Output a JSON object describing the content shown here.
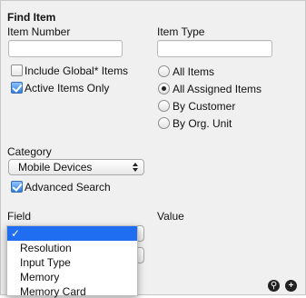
{
  "panel": {
    "title": "Find Item"
  },
  "item_number": {
    "label": "Item Number",
    "value": ""
  },
  "item_type": {
    "label": "Item Type",
    "value": "",
    "options": [
      {
        "label": "All Items",
        "selected": false
      },
      {
        "label": "All Assigned Items",
        "selected": true
      },
      {
        "label": "By Customer",
        "selected": false
      },
      {
        "label": "By Org. Unit",
        "selected": false
      }
    ]
  },
  "checkboxes": {
    "include_global": {
      "label": "Include Global* Items",
      "checked": false
    },
    "active_only": {
      "label": "Active Items Only",
      "checked": true
    },
    "advanced_search": {
      "label": "Advanced Search",
      "checked": true
    }
  },
  "category": {
    "label": "Category",
    "selected": "Mobile Devices"
  },
  "field": {
    "label": "Field"
  },
  "value": {
    "label": "Value"
  },
  "field_dropdown": {
    "highlighted_mark": "✓",
    "options": [
      "Resolution",
      "Input Type",
      "Memory",
      "Memory Card"
    ],
    "highlight_color": "#1f6df0"
  },
  "toolbar": {
    "search_icon_glyph": "⚲",
    "add_icon_glyph": "+"
  }
}
